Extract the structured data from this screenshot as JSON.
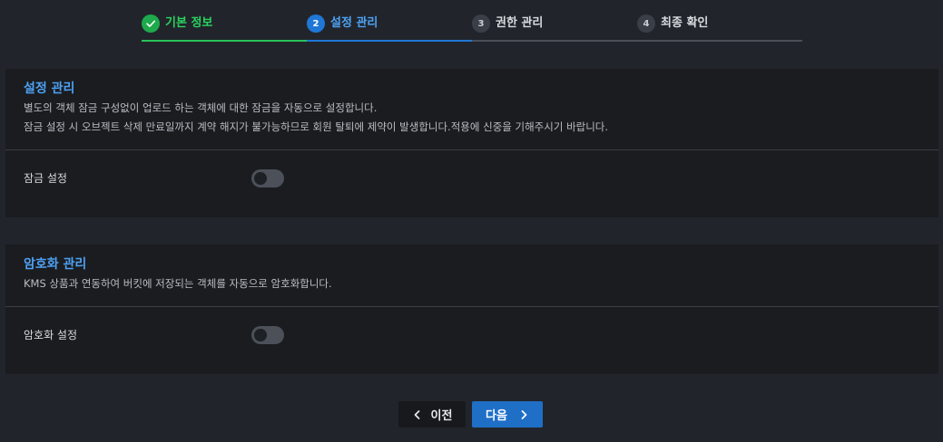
{
  "stepper": {
    "steps": [
      {
        "number": "",
        "label": "기본 정보",
        "state": "done"
      },
      {
        "number": "2",
        "label": "설정 관리",
        "state": "active"
      },
      {
        "number": "3",
        "label": "권한 관리",
        "state": "pending"
      },
      {
        "number": "4",
        "label": "최종 확인",
        "state": "pending"
      }
    ]
  },
  "lock_section": {
    "title": "설정 관리",
    "desc_line1": "별도의 객체 잠금 구성없이 업로드 하는 객체에 대한 잠금을 자동으로 설정합니다.",
    "desc_line2": "잠금 설정 시 오브젝트 삭제 만료일까지 계약 해지가 불가능하므로 회원 탈퇴에 제약이 발생합니다.적용에 신중을 기해주시기 바랍니다.",
    "setting_label": "잠금 설정",
    "setting_enabled": false
  },
  "encryption_section": {
    "title": "암호화 관리",
    "desc_line1": "KMS 상품과 연동하여 버킷에 저장되는 객체를 자동으로 암호화합니다.",
    "setting_label": "암호화 설정",
    "setting_enabled": false
  },
  "buttons": {
    "prev_label": "이전",
    "next_label": "다음"
  },
  "colors": {
    "done": "#2bd35f",
    "active": "#4ea1f3",
    "next_button": "#1f6fc7"
  }
}
